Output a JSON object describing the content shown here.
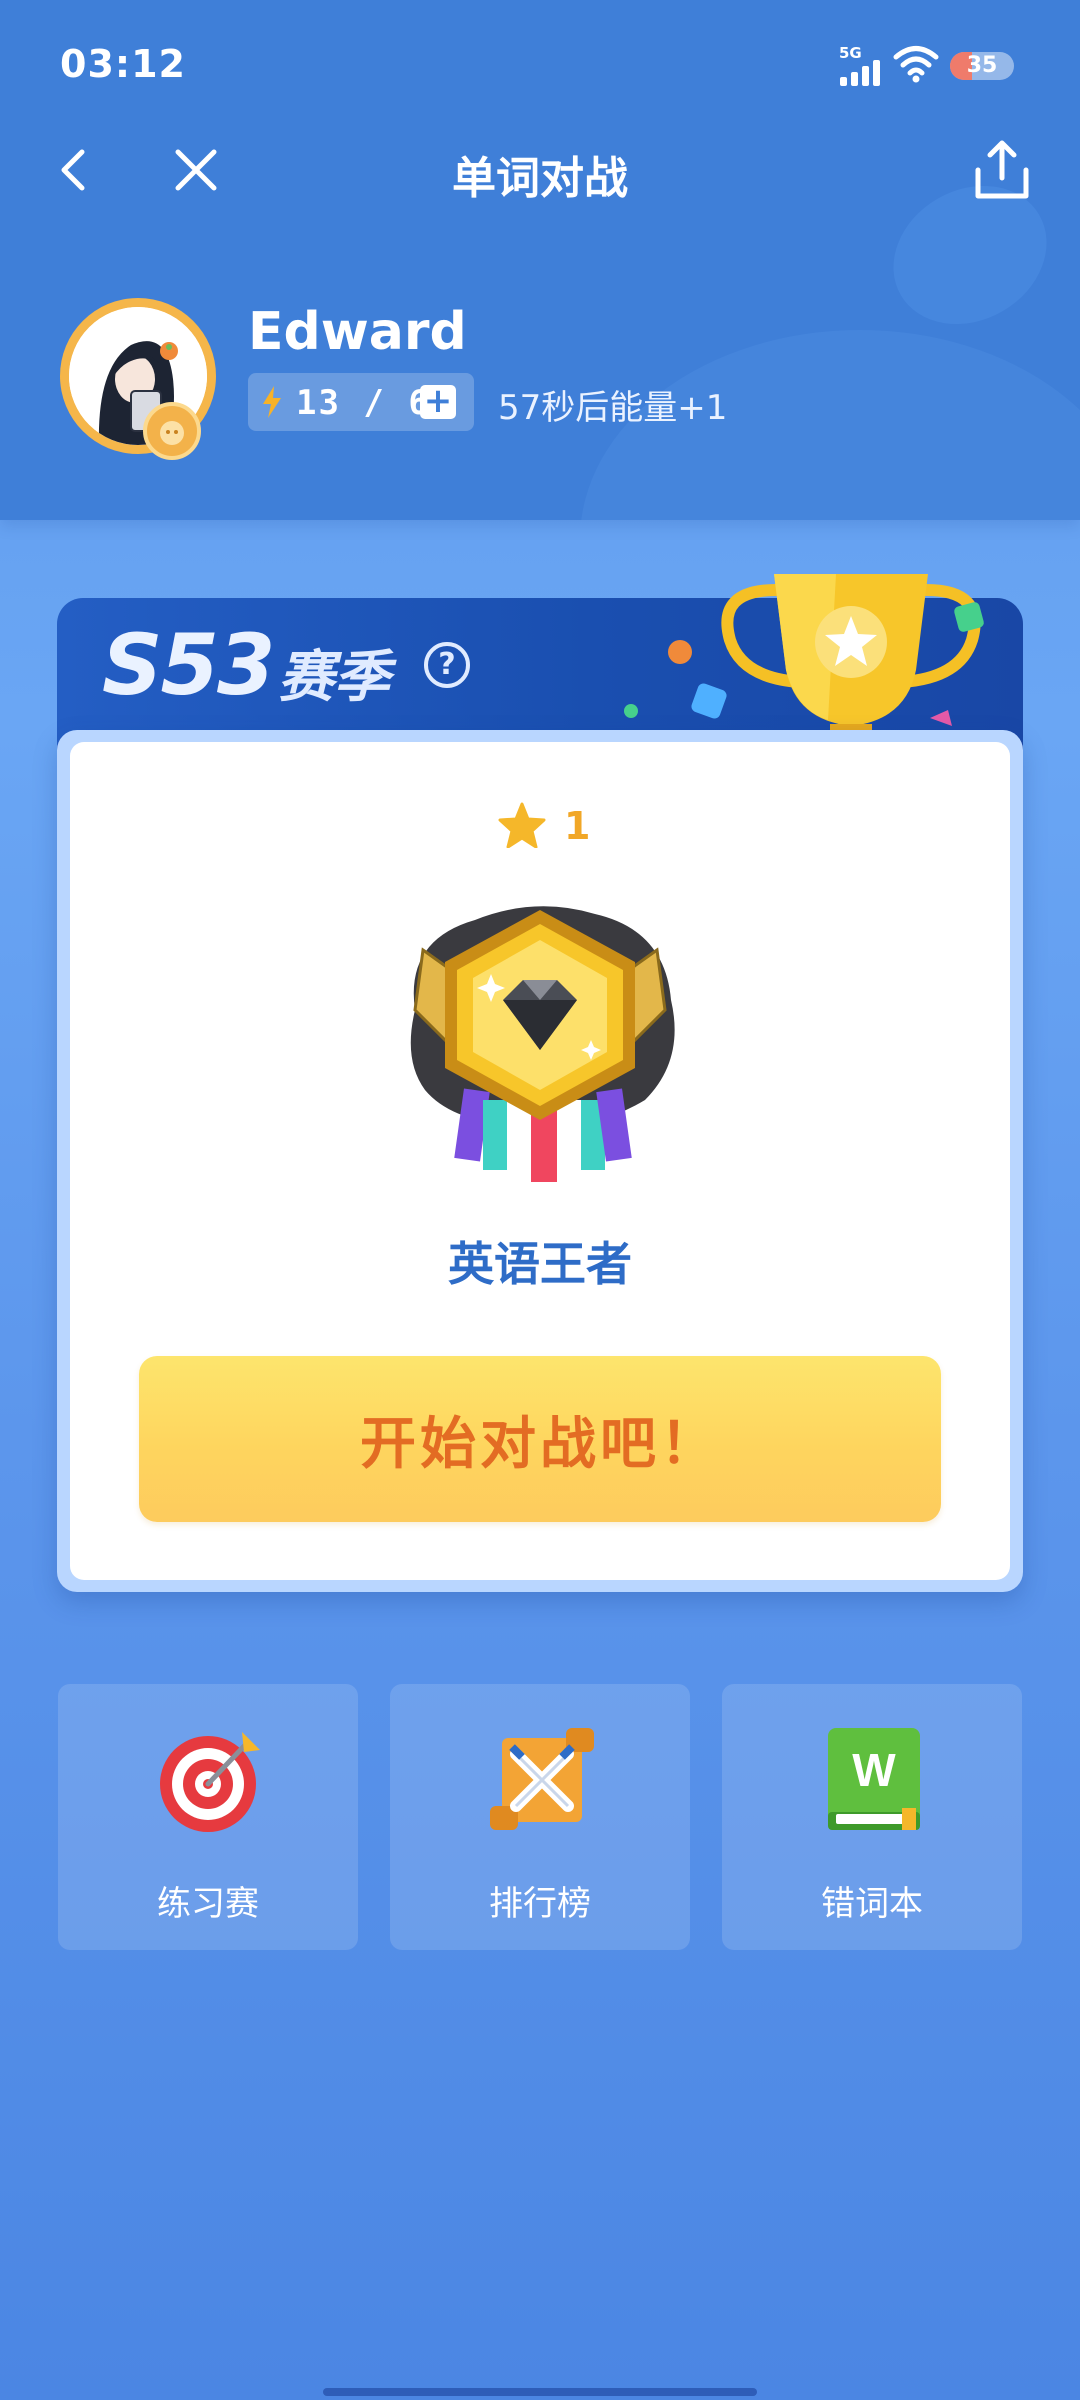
{
  "status_bar": {
    "time": "03:12",
    "network": "5G",
    "battery_level": "35",
    "battery_fraction": 0.35,
    "icons": [
      "signal-icon",
      "wifi-icon",
      "battery-icon"
    ]
  },
  "nav": {
    "title": "单词对战",
    "icons": [
      "back-icon",
      "close-icon",
      "share-icon"
    ]
  },
  "profile": {
    "username": "Edward",
    "energy": "13 / 60",
    "energy_plus": "+",
    "energy_note": "57秒后能量+1"
  },
  "season": {
    "code": "S53",
    "label": "赛季",
    "help": "?",
    "stars": "1",
    "rank_title": "英语王者",
    "start_button": "开始对战吧！"
  },
  "tiles": [
    {
      "label": "练习赛",
      "icon": "target-icon"
    },
    {
      "label": "排行榜",
      "icon": "scroll-swords-icon"
    },
    {
      "label": "错词本",
      "icon": "wordbook-icon"
    }
  ],
  "colors": {
    "header_bg": "#3f7fd8",
    "season_banner": "#1d52b4",
    "button_yellow": "#fed55e",
    "button_text": "#e36c23",
    "rank_text": "#2e6cc7",
    "star": "#f5b72a"
  }
}
